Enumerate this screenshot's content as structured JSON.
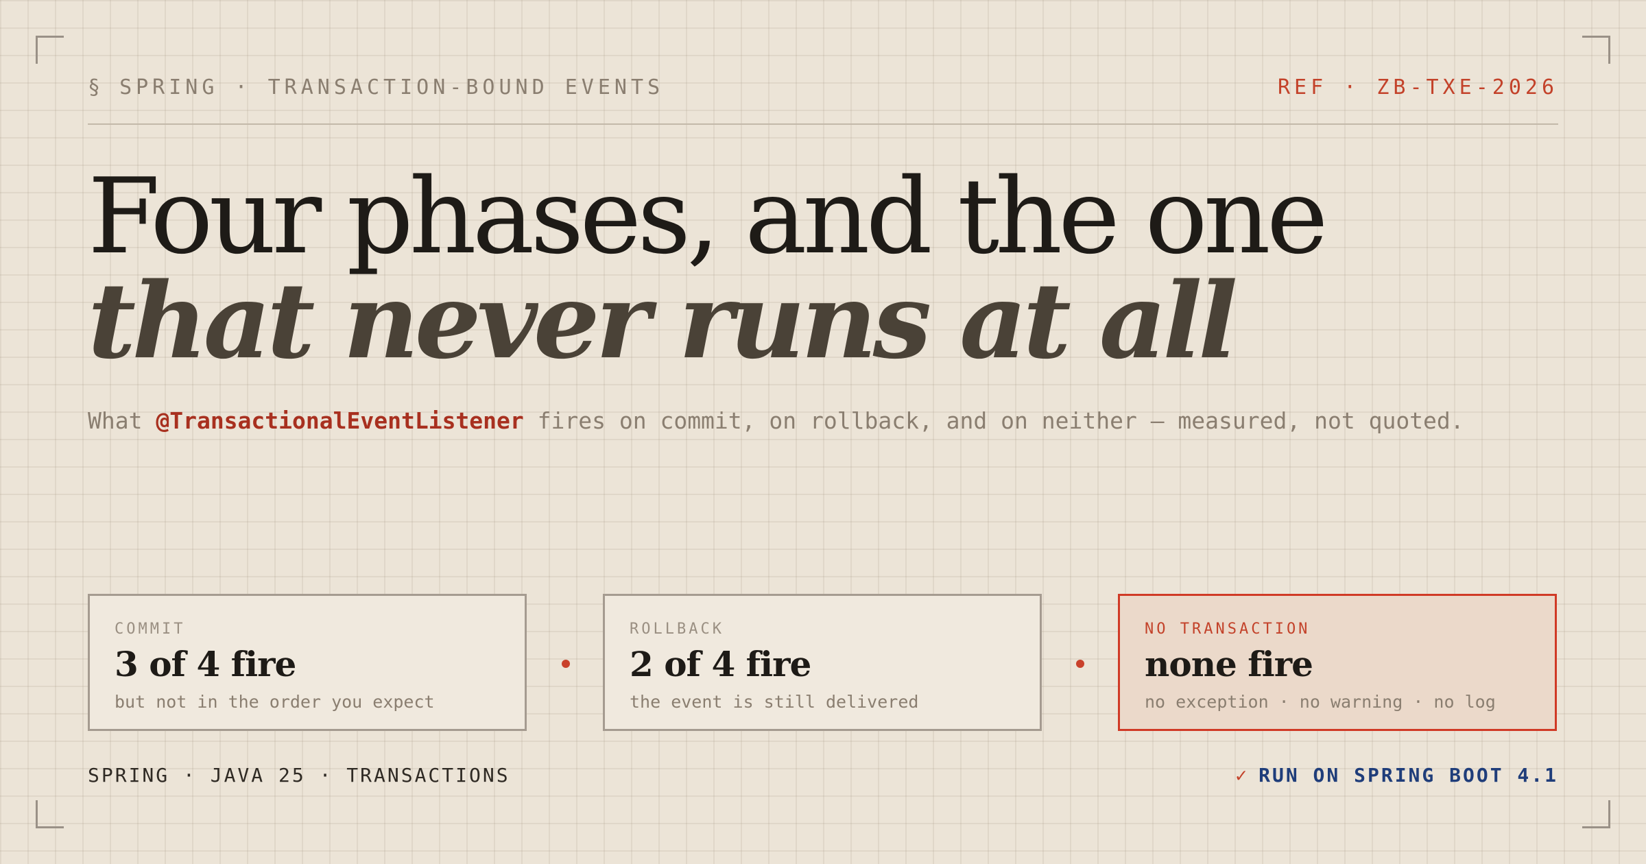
{
  "header": {
    "section_mark": "§",
    "kicker": "SPRING · TRANSACTION-BOUND EVENTS",
    "ref": "REF · ZB-TXE-2026"
  },
  "headline": {
    "line1": "Four phases, and the one",
    "line2": "that never runs at all"
  },
  "subline": {
    "prefix": "What ",
    "code": "@TransactionalEventListener",
    "suffix": " fires on commit, on rollback, and on neither — measured, not quoted."
  },
  "cards": [
    {
      "label": "COMMIT",
      "value": "3 of 4 fire",
      "note": "but not in the order you expect"
    },
    {
      "label": "ROLLBACK",
      "value": "2 of 4 fire",
      "note": "the event is still delivered"
    },
    {
      "label": "NO TRANSACTION",
      "value": "none fire",
      "note": "no exception · no warning · no log"
    }
  ],
  "footer": {
    "left": "SPRING · JAVA 25 · TRANSACTIONS",
    "check_icon": "✓",
    "right": "RUN ON SPRING BOOT 4.1"
  },
  "colors": {
    "background": "#ece4d7",
    "accent": "#c3422a",
    "link_blue": "#1f3d7a",
    "ink": "#1e1b17"
  }
}
